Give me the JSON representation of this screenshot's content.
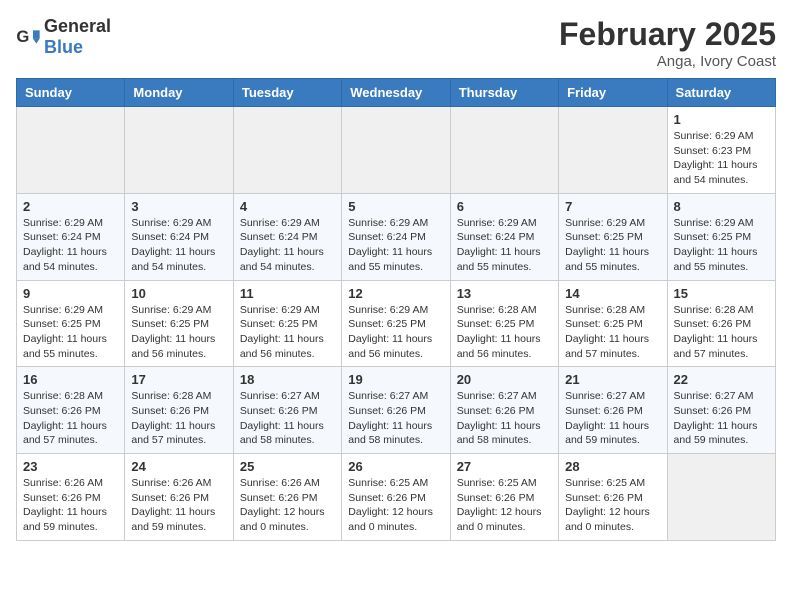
{
  "header": {
    "logo_general": "General",
    "logo_blue": "Blue",
    "month_title": "February 2025",
    "location": "Anga, Ivory Coast"
  },
  "weekdays": [
    "Sunday",
    "Monday",
    "Tuesday",
    "Wednesday",
    "Thursday",
    "Friday",
    "Saturday"
  ],
  "weeks": [
    [
      {
        "day": "",
        "info": ""
      },
      {
        "day": "",
        "info": ""
      },
      {
        "day": "",
        "info": ""
      },
      {
        "day": "",
        "info": ""
      },
      {
        "day": "",
        "info": ""
      },
      {
        "day": "",
        "info": ""
      },
      {
        "day": "1",
        "info": "Sunrise: 6:29 AM\nSunset: 6:23 PM\nDaylight: 11 hours\nand 54 minutes."
      }
    ],
    [
      {
        "day": "2",
        "info": "Sunrise: 6:29 AM\nSunset: 6:24 PM\nDaylight: 11 hours\nand 54 minutes."
      },
      {
        "day": "3",
        "info": "Sunrise: 6:29 AM\nSunset: 6:24 PM\nDaylight: 11 hours\nand 54 minutes."
      },
      {
        "day": "4",
        "info": "Sunrise: 6:29 AM\nSunset: 6:24 PM\nDaylight: 11 hours\nand 54 minutes."
      },
      {
        "day": "5",
        "info": "Sunrise: 6:29 AM\nSunset: 6:24 PM\nDaylight: 11 hours\nand 55 minutes."
      },
      {
        "day": "6",
        "info": "Sunrise: 6:29 AM\nSunset: 6:24 PM\nDaylight: 11 hours\nand 55 minutes."
      },
      {
        "day": "7",
        "info": "Sunrise: 6:29 AM\nSunset: 6:25 PM\nDaylight: 11 hours\nand 55 minutes."
      },
      {
        "day": "8",
        "info": "Sunrise: 6:29 AM\nSunset: 6:25 PM\nDaylight: 11 hours\nand 55 minutes."
      }
    ],
    [
      {
        "day": "9",
        "info": "Sunrise: 6:29 AM\nSunset: 6:25 PM\nDaylight: 11 hours\nand 55 minutes."
      },
      {
        "day": "10",
        "info": "Sunrise: 6:29 AM\nSunset: 6:25 PM\nDaylight: 11 hours\nand 56 minutes."
      },
      {
        "day": "11",
        "info": "Sunrise: 6:29 AM\nSunset: 6:25 PM\nDaylight: 11 hours\nand 56 minutes."
      },
      {
        "day": "12",
        "info": "Sunrise: 6:29 AM\nSunset: 6:25 PM\nDaylight: 11 hours\nand 56 minutes."
      },
      {
        "day": "13",
        "info": "Sunrise: 6:28 AM\nSunset: 6:25 PM\nDaylight: 11 hours\nand 56 minutes."
      },
      {
        "day": "14",
        "info": "Sunrise: 6:28 AM\nSunset: 6:25 PM\nDaylight: 11 hours\nand 57 minutes."
      },
      {
        "day": "15",
        "info": "Sunrise: 6:28 AM\nSunset: 6:26 PM\nDaylight: 11 hours\nand 57 minutes."
      }
    ],
    [
      {
        "day": "16",
        "info": "Sunrise: 6:28 AM\nSunset: 6:26 PM\nDaylight: 11 hours\nand 57 minutes."
      },
      {
        "day": "17",
        "info": "Sunrise: 6:28 AM\nSunset: 6:26 PM\nDaylight: 11 hours\nand 57 minutes."
      },
      {
        "day": "18",
        "info": "Sunrise: 6:27 AM\nSunset: 6:26 PM\nDaylight: 11 hours\nand 58 minutes."
      },
      {
        "day": "19",
        "info": "Sunrise: 6:27 AM\nSunset: 6:26 PM\nDaylight: 11 hours\nand 58 minutes."
      },
      {
        "day": "20",
        "info": "Sunrise: 6:27 AM\nSunset: 6:26 PM\nDaylight: 11 hours\nand 58 minutes."
      },
      {
        "day": "21",
        "info": "Sunrise: 6:27 AM\nSunset: 6:26 PM\nDaylight: 11 hours\nand 59 minutes."
      },
      {
        "day": "22",
        "info": "Sunrise: 6:27 AM\nSunset: 6:26 PM\nDaylight: 11 hours\nand 59 minutes."
      }
    ],
    [
      {
        "day": "23",
        "info": "Sunrise: 6:26 AM\nSunset: 6:26 PM\nDaylight: 11 hours\nand 59 minutes."
      },
      {
        "day": "24",
        "info": "Sunrise: 6:26 AM\nSunset: 6:26 PM\nDaylight: 11 hours\nand 59 minutes."
      },
      {
        "day": "25",
        "info": "Sunrise: 6:26 AM\nSunset: 6:26 PM\nDaylight: 12 hours\nand 0 minutes."
      },
      {
        "day": "26",
        "info": "Sunrise: 6:25 AM\nSunset: 6:26 PM\nDaylight: 12 hours\nand 0 minutes."
      },
      {
        "day": "27",
        "info": "Sunrise: 6:25 AM\nSunset: 6:26 PM\nDaylight: 12 hours\nand 0 minutes."
      },
      {
        "day": "28",
        "info": "Sunrise: 6:25 AM\nSunset: 6:26 PM\nDaylight: 12 hours\nand 0 minutes."
      },
      {
        "day": "",
        "info": ""
      }
    ]
  ]
}
